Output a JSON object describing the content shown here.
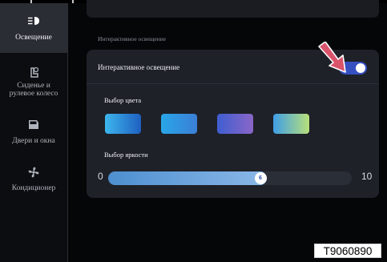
{
  "sidebar": {
    "items": [
      {
        "label": "Освещение",
        "icon": "headlight-icon",
        "active": true
      },
      {
        "label": "Сиденье и\nрулевое колесо",
        "icon": "seat-steering-icon",
        "active": false
      },
      {
        "label": "Двери и окна",
        "icon": "door-window-icon",
        "active": false
      },
      {
        "label": "Кондиционер",
        "icon": "fan-icon",
        "active": false
      }
    ]
  },
  "main": {
    "section_title": "Интерактивное освещение",
    "toggle_row": {
      "label": "Интерактивное освещение",
      "enabled": true
    },
    "color_title": "Выбор цвета",
    "swatches": [
      {
        "gradient_start": "#3db7ee",
        "gradient_end": "#1f5fc0"
      },
      {
        "gradient_start": "#29a6e8",
        "gradient_end": "#3b7fd6"
      },
      {
        "gradient_start": "#3f5ed0",
        "gradient_end": "#8a66c8"
      },
      {
        "gradient_start": "#3f9ee6",
        "gradient_end": "#b8e07a"
      }
    ],
    "brightness_title": "Выбор яркости",
    "brightness": {
      "min": "0",
      "max": "10",
      "value": 6,
      "value_label": "6"
    }
  },
  "accent_color": "#3650c2",
  "arrow_color": "#d9536a",
  "image_code": "T9060890"
}
